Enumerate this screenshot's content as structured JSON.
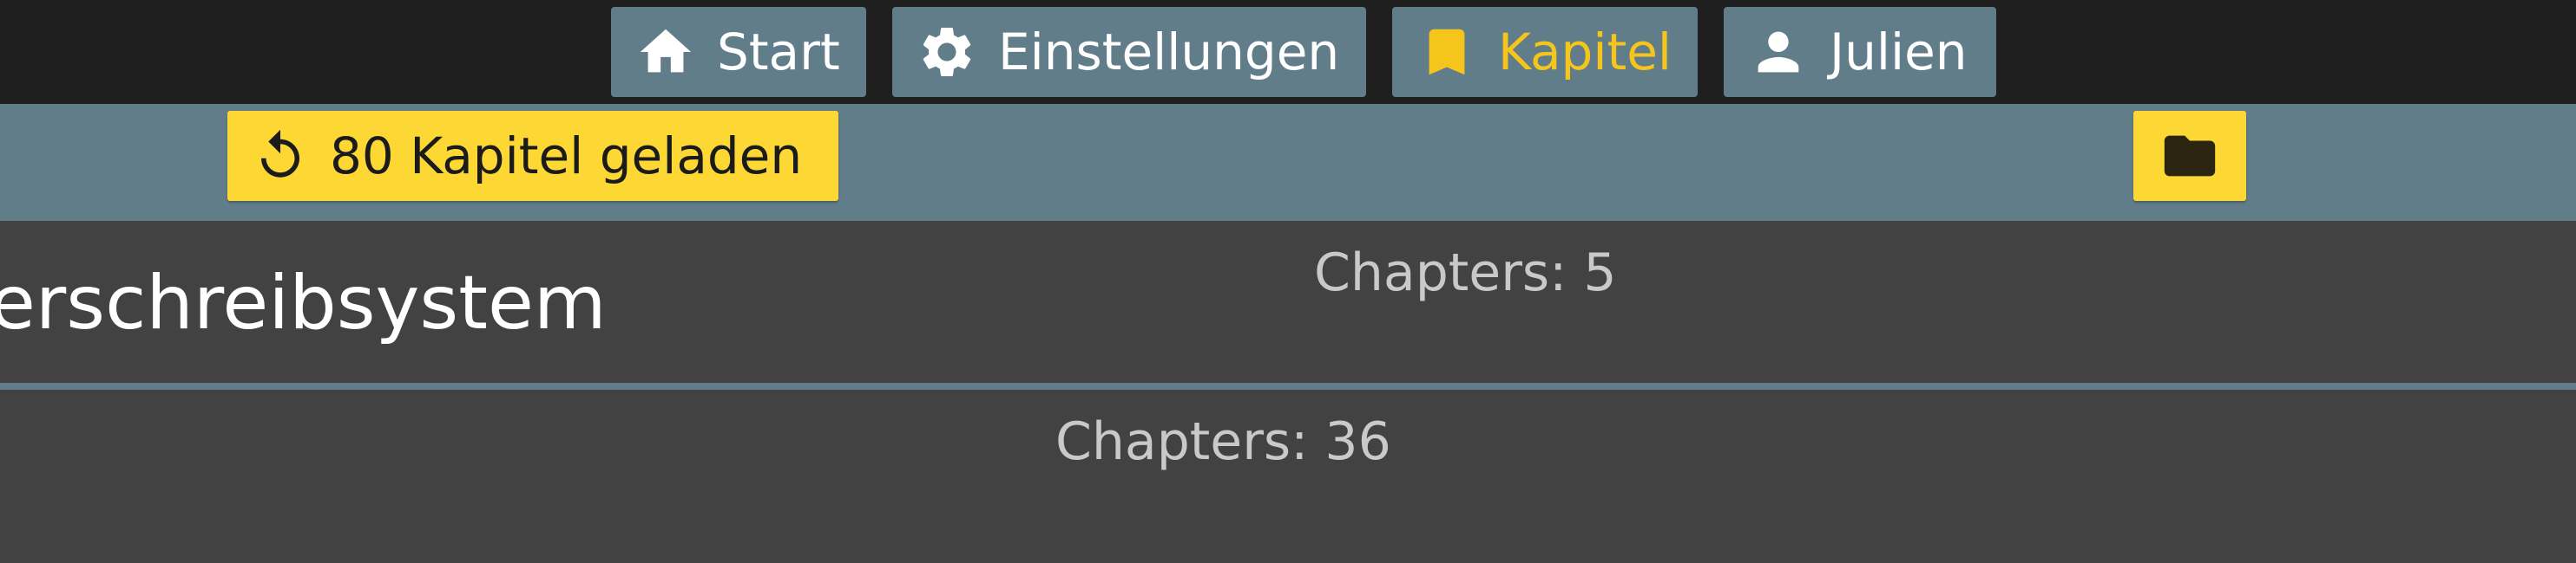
{
  "nav": {
    "items": [
      {
        "label": "Start",
        "icon": "home-icon"
      },
      {
        "label": "Einstellungen",
        "icon": "gear-icon"
      },
      {
        "label": "Kapitel",
        "icon": "bookmark-icon",
        "active": true
      },
      {
        "label": "Julien",
        "icon": "user-icon"
      }
    ]
  },
  "toolbar": {
    "reload_label": "80 Kapitel geladen",
    "reload_icon": "reload-icon",
    "folder_icon": "folder-icon"
  },
  "books": [
    {
      "title": "erschreibsystem",
      "count": "Chapters: 5"
    },
    {
      "title": "",
      "count": "Chapters: 36"
    }
  ],
  "colors": {
    "nav_background": "#1f1f1f",
    "button_background": "#617d8a",
    "accent": "#f6c51b",
    "primary_button": "#fdd835",
    "row_background": "#424242"
  }
}
